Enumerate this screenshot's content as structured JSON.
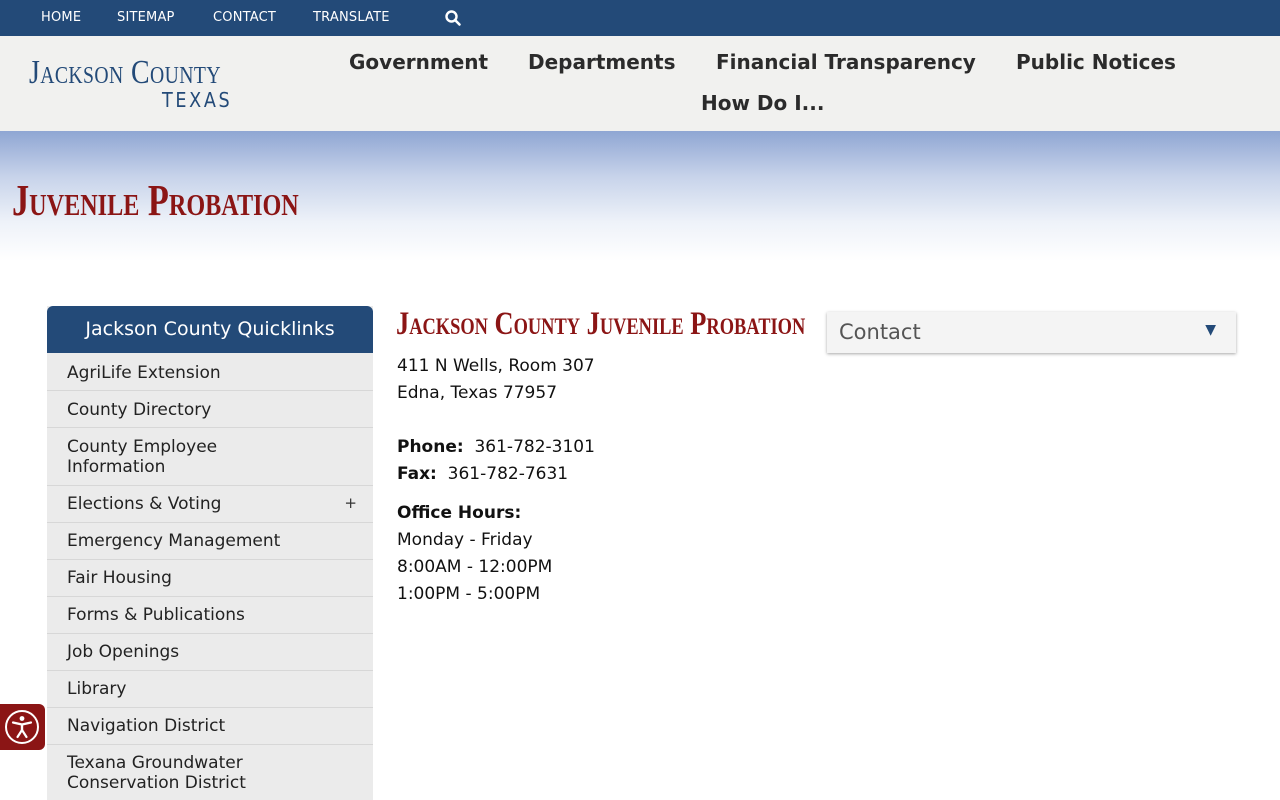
{
  "utility_nav": {
    "items": [
      "HOME",
      "SITEMAP",
      "CONTACT",
      "TRANSLATE"
    ],
    "search_icon": "search-icon"
  },
  "logo": {
    "line1": "Jackson County",
    "line2": "TEXAS"
  },
  "main_nav": {
    "items": [
      "Government",
      "Departments",
      "Financial Transparency",
      "Public Notices",
      "How Do I..."
    ]
  },
  "page": {
    "title": "Juvenile Probation"
  },
  "sidebar": {
    "title": "Jackson County Quicklinks",
    "items": [
      {
        "label": "AgriLife Extension"
      },
      {
        "label": "County Directory"
      },
      {
        "label": "County Employee Information"
      },
      {
        "label": "Elections & Voting",
        "expand": "+"
      },
      {
        "label": "Emergency Management"
      },
      {
        "label": "Fair Housing"
      },
      {
        "label": "Forms & Publications"
      },
      {
        "label": "Job Openings"
      },
      {
        "label": "Library"
      },
      {
        "label": "Navigation District"
      },
      {
        "label": "Texana Groundwater Conservation District"
      }
    ]
  },
  "content": {
    "title": "Jackson County Juvenile Probation",
    "address1": "411 N Wells, Room 307",
    "address2": "Edna, Texas 77957",
    "phone_label": "Phone:",
    "phone": "361-782-3101",
    "fax_label": "Fax:",
    "fax": "361-782-7631",
    "hours_label": "Office Hours:",
    "hours_days": "Monday - Friday",
    "hours_am": "8:00AM - 12:00PM",
    "hours_pm": "1:00PM - 5:00PM"
  },
  "contact_panel": {
    "label": "Contact",
    "arrow": "▼"
  },
  "colors": {
    "brand_blue": "#234a78",
    "brand_red": "#8b1515"
  }
}
